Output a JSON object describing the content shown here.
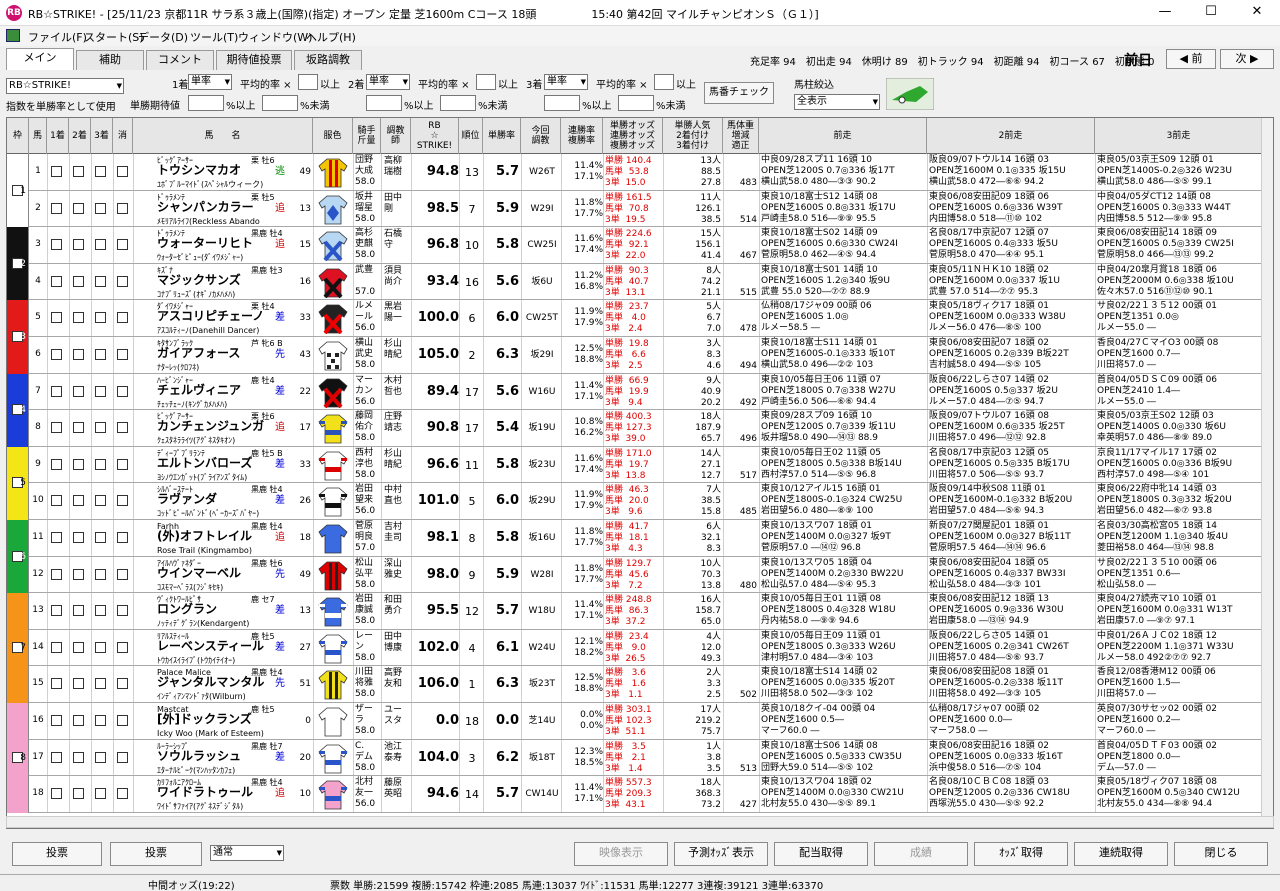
{
  "window": {
    "app_icon_label": "RB",
    "title": "RB☆STRIKE! - [25/11/23 京都11R サラ系３歳上(国際)(指定) オープン 定量 芝1600m Cコース 18頭　　　　　15:40 第42回 マイルチャンピオンＳ（Ｇ１）]",
    "minimize": "—",
    "maximize": "☐",
    "close": "✕"
  },
  "menu": [
    "ファイル(F)",
    "スタート(S)",
    "データ(D)",
    "ツール(T)",
    "ウィンドウ(W)",
    "ヘルプ(H)"
  ],
  "tabs": [
    "メイン",
    "補助",
    "コメント",
    "期待値投票",
    "坂路調教"
  ],
  "race_stats": {
    "text": "充足率 94　初出走 94　休明け 89　初トラック 94　初距離 94　初コース 67　初状態 0",
    "prev_day": "前日",
    "prev_btn": "◀ 前",
    "next_btn": "次 ▶"
  },
  "controls": {
    "profile": "RB☆STRIKE!",
    "use_label": "指数を単勝率として使用",
    "place1": "1着",
    "place2": "2着",
    "place3": "3着",
    "bet_type": "単率",
    "avg_label": "平均的率 ×",
    "above": "以上",
    "tan_exp": "単勝期待値",
    "pct_above": "%以上",
    "pct_below": "%未満",
    "check_btn": "馬番チェック",
    "filter_label": "馬柱絞込",
    "filter_value": "全表示"
  },
  "columns": [
    "枠",
    "馬",
    "1着",
    "2着",
    "3着",
    "消",
    "馬　　名",
    "服色",
    "騎手\n斤量",
    "調教\n師",
    "RB\n☆\nSTRIKE!",
    "順位",
    "単勝率",
    "今回\n調教",
    "連勝率\n複勝率",
    "単勝オッズ\n連勝オッズ\n複勝オッズ",
    "単勝人気\n2着付け\n3着付け",
    "馬体重\n増減\n適正",
    "前走",
    "2前走",
    "3前走"
  ],
  "horses": [
    {
      "waku": "1",
      "num": "1",
      "sire": "ﾋﾞｯｸﾞｱｰｻｰ",
      "sex": "栗 牡6",
      "name": "トウシンマカオ",
      "dam": "ﾕﾎﾞﾌﾞﾙｰﾏｲﾄﾞ(ｽﾍﾟｼｬﾙウィーク)",
      "style": "逃",
      "idx": "49",
      "jockey": "団野\n大成\n58.0",
      "trainer": "高柳\n瑞樹",
      "score": "94.8",
      "rank": "13",
      "win": "5.7",
      "train": "W26T",
      "rate": "11.4%\n17.1%",
      "odds": "単勝 140.4\n馬単  53.8\n3単  15.0",
      "pop": "13人\n88.5\n27.8",
      "wt": "483",
      "p1": [
        "中良09/28スプ11 16頭 10",
        "OPEN芝1200S 0.7◎336 坂17T",
        "横山武58.0 480―③③ 90.2"
      ],
      "p2": [
        "阪良09/07トウル14 16頭 03",
        "OPEN芝1600M 0.1◎335 坂15U",
        "横山武58.0 472―⑥⑥ 94.2"
      ],
      "p3": [
        "東良05/03京王S09 12頭 01",
        "OPEN芝1400S-0.2◎326 W23U",
        "横山武58.0 486―⑤⑤ 99.1"
      ]
    },
    {
      "waku": "1",
      "num": "2",
      "sire": "ﾄﾞｩﾗﾒﾝﾃ",
      "sex": "栗 牡5",
      "name": "シャンパンカラー",
      "dam": "ﾒﾓﾘｱﾙﾗｲﾌ(Reckless Abando",
      "style": "追",
      "idx": "13",
      "jockey": "坂井\n瑠星\n58.0",
      "trainer": "田中\n剛",
      "score": "98.5",
      "rank": "7",
      "win": "5.9",
      "train": "W29I",
      "rate": "11.8%\n17.7%",
      "odds": "単勝 161.5\n馬単  70.8\n3単  19.5",
      "pop": "11人\n126.1\n38.5",
      "wt": "514",
      "p1": [
        "東良10/18富士S12 14頭 08",
        "OPEN芝1600S 0.8◎331 坂17U",
        "戸崎圭58.0 516―⑨⑨ 95.5"
      ],
      "p2": [
        "東良06/08安田記09 18頭 06",
        "OPEN芝1600S 0.6◎336 W39T",
        "内田博58.0 518―⑪⑩ 102"
      ],
      "p3": [
        "中良04/05ダCT12 14頭 08",
        "OPEN芝1600S 0.3◎333 W44T",
        "内田博58.5 512―⑨⑨ 95.8"
      ]
    },
    {
      "waku": "2",
      "num": "3",
      "sire": "ﾄﾞｩﾗﾒﾝﾃ",
      "sex": "黒鹿 牡4",
      "name": "ウォーターリヒト",
      "dam": "ｳｫｰﾀｰｾﾞﾋﾟｭｰ(ﾀﾞｲﾜﾒｼﾞｬｰ)",
      "style": "追",
      "idx": "15",
      "jockey": "高杉\n吏麒\n58.0",
      "trainer": "石橋\n守",
      "score": "96.8",
      "rank": "10",
      "win": "5.8",
      "train": "CW25I",
      "rate": "11.6%\n17.4%",
      "odds": "単勝 224.6\n馬単  92.1\n3単  22.0",
      "pop": "15人\n156.1\n41.4",
      "wt": "467",
      "p1": [
        "東良10/18富士S02 14頭 09",
        "OPEN芝1600S 0.6◎330 CW24I",
        "菅原明58.0 462―④⑤ 94.4"
      ],
      "p2": [
        "名良08/17中京記07 12頭 07",
        "OPEN芝1600S 0.4◎333 坂5U",
        "菅原明58.0 470―④④ 95.1"
      ],
      "p3": [
        "東良06/08安田記14 18頭 09",
        "OPEN芝1600S 0.5◎339 CW25I",
        "菅原明58.0 466―⑬⑬ 99.2"
      ]
    },
    {
      "waku": "2",
      "num": "4",
      "sire": "ｷｽﾞﾅ",
      "sex": "黒鹿 牡3",
      "name": "マジックサンズ",
      "dam": "ｺﾅﾌﾞﾘｭｰｽﾞ(ｵｷﾞﾉｶﾒﾊﾒﾊ)",
      "style": "",
      "idx": "16",
      "jockey": "武豊\n\n57.0",
      "trainer": "須貝\n尚介",
      "score": "93.4",
      "rank": "16",
      "win": "5.6",
      "train": "坂6U",
      "rate": "11.2%\n16.8%",
      "odds": "単勝  90.3\n馬単  40.7\n3単  13.1",
      "pop": "8人\n74.2\n21.1",
      "wt": "515",
      "p1": [
        "東良10/18富士S01 14頭 10",
        "OPEN芝1600S 1.2◎340 坂9U",
        "武豊  55.0 520―⑦⑦ 88.9"
      ],
      "p2": [
        "東良05/11ＮＨＫ10 18頭 02",
        "OPEN芝1600M 0.0◎337 坂1U",
        "武豊  57.0 514―⑦⑦ 95.3"
      ],
      "p3": [
        "中良04/20皐月賞18 18頭 06",
        "OPEN芝2000M 0.6◎338 坂10U",
        "佐々木57.0 516⑪⑫⑩ 90.1"
      ]
    },
    {
      "waku": "3",
      "num": "5",
      "sire": "ﾀﾞｲﾜﾒｼﾞｬｰ",
      "sex": "栗 牡4",
      "name": "アスコリピチェーノ",
      "dam": "ｱｽｺﾙﾃｨｰﾉ(Danehill Dancer)",
      "style": "差",
      "idx": "33",
      "jockey": "ルメ\nール\n56.0",
      "trainer": "黒岩\n陽一",
      "score": "100.0",
      "rank": "6",
      "win": "6.0",
      "train": "CW25T",
      "rate": "11.9%\n17.9%",
      "odds": "単勝  23.7\n馬単   4.0\n3単   2.4",
      "pop": "5人\n6.7\n7.0",
      "wt": "478",
      "p1": [
        "仏稍08/17ジャ09 00頭 06",
        "OPEN芝1600S 1.0◎",
        "ルメー58.5 ―"
      ],
      "p2": [
        "東良05/18ヴィク17 18頭 01",
        "OPEN芝1600M 0.0◎333 W38U",
        "ルメー56.0 476―⑧⑤ 100"
      ],
      "p3": [
        "サ良02/22１３５12 00頭 01",
        "OPEN芝1351 0.0◎",
        "ルメー55.0 ―"
      ]
    },
    {
      "waku": "3",
      "num": "6",
      "sire": "ｷﾀｻﾝﾌﾞﾗｯｸ",
      "sex": "芦 牝6 B",
      "name": "ガイアフォース",
      "dam": "ﾅﾀｰﾚｯ(ｸﾛﾌﾈ)",
      "style": "先",
      "idx": "43",
      "jockey": "横山\n武史\n58.0",
      "trainer": "杉山\n晴紀",
      "score": "105.0",
      "rank": "2",
      "win": "6.3",
      "train": "坂29I",
      "rate": "12.5%\n18.8%",
      "odds": "単勝  19.8\n馬単   6.6\n3単   2.5",
      "pop": "3人\n8.3\n4.6",
      "wt": "494",
      "p1": [
        "東良10/18富士S11 14頭 01",
        "OPEN芝1600S-0.1◎333 坂10T",
        "横山武58.0 496―②② 103"
      ],
      "p2": [
        "東良06/08安田記07 18頭 02",
        "OPEN芝1600S 0.2◎339 B坂22T",
        "吉村誠58.0 494―⑤⑤ 105"
      ],
      "p3": [
        "香良04/27ＣマイO3 00頭 08",
        "OPEN芝1600 0.7―",
        "川田将57.0 ―"
      ]
    },
    {
      "waku": "4",
      "num": "7",
      "sire": "ﾊｰﾋﾞﾝｼﾞｬｰ",
      "sex": "鹿 牡4",
      "name": "チェルヴィニア",
      "dam": "ﾁｪｯﾁｪｰﾉ(ｷﾝｸﾞｶﾒﾊﾒﾊ)",
      "style": "差",
      "idx": "22",
      "jockey": "マー\nカン\n56.0",
      "trainer": "木村\n哲也",
      "score": "89.4",
      "rank": "17",
      "win": "5.6",
      "train": "W16U",
      "rate": "11.4%\n17.1%",
      "odds": "単勝  66.9\n馬単  19.9\n3単   9.4",
      "pop": "9人\n40.9\n20.2",
      "wt": "492",
      "p1": [
        "東良10/05毎日王06 11頭 07",
        "OPEN芝1800S 0.7◎338 W27U",
        "戸崎圭56.0 506―⑥⑥ 94.4"
      ],
      "p2": [
        "阪良06/22しらさ07 14頭 02",
        "OPEN芝1600S 0.5◎337 坂2U",
        "ルメー57.0 484―⑦⑤ 94.7"
      ],
      "p3": [
        "首良04/05ＤＳＣ09 00頭 06",
        "OPEN芝2410 1.4―",
        "ルメー55.0 ―"
      ]
    },
    {
      "waku": "4",
      "num": "8",
      "sire": "ﾋﾞｯｸﾞｱｰｻｰ",
      "sex": "栗 牡6",
      "name": "カンチェンジュンガ",
      "dam": "ｸｪｽﾀﾈﾗﾗｲﾂ(ｱｸﾞﾈｽﾀｷｵﾝ)",
      "style": "追",
      "idx": "17",
      "jockey": "藤岡\n佑介\n58.0",
      "trainer": "庄野\n靖志",
      "score": "90.8",
      "rank": "17",
      "win": "5.4",
      "train": "坂19U",
      "rate": "10.8%\n16.2%",
      "odds": "単勝 400.3\n馬単 127.3\n3単  39.0",
      "pop": "18人\n187.9\n65.7",
      "wt": "496",
      "p1": [
        "東良09/28スプ09 16頭 10",
        "OPEN芝1200S 0.7◎339 坂11U",
        "坂井瑠58.0 490―⑭⑬ 88.9"
      ],
      "p2": [
        "阪良09/07トウル07 16頭 08",
        "OPEN芝1600M 0.6◎335 坂25T",
        "川田将57.0 496―⑫⑫ 92.8"
      ],
      "p3": [
        "東良05/03京王S02 12頭 03",
        "OPEN芝1400S 0.0◎330 坂6U",
        "幸英明57.0 486―⑧⑨ 89.0"
      ]
    },
    {
      "waku": "5",
      "num": "9",
      "sire": "ﾃﾞｨｰﾌﾟﾌﾞﾘﾗﾝﾃ",
      "sex": "鹿 牡5 B",
      "name": "エルトンバローズ",
      "dam": "ﾖｼﾉｳｴﾝｶﾞｯﾄ(ﾌﾞﾗｲｱﾝｽﾞﾀｲﾑ)",
      "style": "差",
      "idx": "33",
      "jockey": "西村\n淳也\n58.0",
      "trainer": "杉山\n晴紀",
      "score": "96.6",
      "rank": "11",
      "win": "5.8",
      "train": "坂23U",
      "rate": "11.6%\n17.4%",
      "odds": "単勝 171.0\n馬単  19.7\n3単  13.8",
      "pop": "14人\n27.1\n12.7",
      "wt": "517",
      "p1": [
        "東良10/05毎日王02 11頭 05",
        "OPEN芝1800S 0.5◎338 B坂14U",
        "西村淳57.0 514―⑤⑤ 96.8"
      ],
      "p2": [
        "名良08/17中京記03 12頭 05",
        "OPEN芝1600S 0.5◎335 B坂17U",
        "川田将57.0 506―⑤⑤ 93.7"
      ],
      "p3": [
        "京良11/17マイル17 17頭 02",
        "OPEN芝1600S 0.0◎336 B坂9U",
        "西村淳57.0 498―⑤④ 101"
      ]
    },
    {
      "waku": "5",
      "num": "10",
      "sire": "ｼﾙﾊﾞｰｽﾃｰﾄ",
      "sex": "黒鹿 牡4",
      "name": "ラヴァンダ",
      "dam": "ｺｯﾄﾞﾋﾟｰﾙﾊﾞﾝﾄﾞ(ﾍﾞｰｶｰｽﾞﾊﾞﾔｰ)",
      "style": "差",
      "idx": "26",
      "jockey": "岩田\n望来\n56.0",
      "trainer": "中村\n直也",
      "score": "101.0",
      "rank": "5",
      "win": "6.0",
      "train": "坂29U",
      "rate": "11.9%\n17.9%",
      "odds": "単勝  46.3\n馬単  20.0\n3単   9.6",
      "pop": "7人\n38.5\n15.8",
      "wt": "485",
      "p1": [
        "東良10/12アイル15 16頭 01",
        "OPEN芝1800S-0.1◎324 CW25U",
        "岩田望56.0 480―⑧⑨ 100"
      ],
      "p2": [
        "阪良09/14中秋S08 11頭 01",
        "OPEN芝1600M-0.1◎332 B坂20U",
        "岩田望57.0 484―⑤⑥ 94.3"
      ],
      "p3": [
        "東良06/22府中牝14 14頭 03",
        "OPEN芝1800S 0.3◎332 坂20U",
        "岩田望56.0 482―⑥⑦ 93.8"
      ]
    },
    {
      "waku": "6",
      "num": "11",
      "sire": "Farhh",
      "sex": "黒鹿 牡4",
      "name": "(外)オフトレイル",
      "dam": "Rose Trail (Kingmambo)",
      "style": "追",
      "idx": "18",
      "jockey": "菅原\n明良\n57.0",
      "trainer": "吉村\n圭司",
      "score": "98.1",
      "rank": "8",
      "win": "5.8",
      "train": "坂16U",
      "rate": "11.8%\n17.7%",
      "odds": "単勝  41.7\n馬単  18.1\n3単   4.3",
      "pop": "6人\n32.1\n8.3",
      "wt": "",
      "p1": [
        "東良10/13スワ07 18頭 01",
        "OPEN芝1400M 0.0◎327 坂9T",
        "菅原明57.0 ―⑭⑫ 96.8"
      ],
      "p2": [
        "新良07/27関屋記01 18頭 01",
        "OPEN芝1600M 0.0◎327 B坂11T",
        "菅原明57.5 464―⑭⑭ 96.6"
      ],
      "p3": [
        "名良03/30高松宮05 18頭 14",
        "OPEN芝1200M 1.1◎340 坂4U",
        "菱田裕58.0 464―⑬⑭ 98.8"
      ]
    },
    {
      "waku": "6",
      "num": "12",
      "sire": "ｱｲﾙﾊｳﾞｧﾈﾀﾞｰ",
      "sex": "黒鹿 牡6",
      "name": "ウインマーベル",
      "dam": "ｺｽﾓﾏｰﾍﾞﾗｽ(ﾌｼﾞｷｾｷ)",
      "style": "先",
      "idx": "49",
      "jockey": "松山\n弘平\n58.0",
      "trainer": "深山\n雅史",
      "score": "98.0",
      "rank": "9",
      "win": "5.9",
      "train": "W28I",
      "rate": "11.8%\n17.7%",
      "odds": "単勝 129.7\n馬単  45.6\n3単   7.2",
      "pop": "10人\n70.3\n13.8",
      "wt": "480",
      "p1": [
        "東良10/13スワ05 18頭 04",
        "OPEN芝1400M 0.2◎330 BW22U",
        "松山弘57.0 484―⑤④ 95.3"
      ],
      "p2": [
        "東良06/08安田記04 18頭 05",
        "OPEN芝1600S 0.4◎337 BW33I",
        "松山弘58.0 484―③③ 101"
      ],
      "p3": [
        "サ良02/22１３５10 00頭 06",
        "OPEN芝1351 0.6―",
        "松山弘58.0 ―"
      ]
    },
    {
      "waku": "7",
      "num": "13",
      "sire": "ｳﾞｨｸﾄﾜｰﾙﾋﾟｻ",
      "sex": "鹿 セ7",
      "name": "ロングラン",
      "dam": "ﾉｯﾃｨﾃﾞｸﾞﾗﾝ(Kendargent)",
      "style": "差",
      "idx": "13",
      "jockey": "岩田\n康誠\n58.0",
      "trainer": "和田\n勇介",
      "score": "95.5",
      "rank": "12",
      "win": "5.7",
      "train": "W18U",
      "rate": "11.4%\n17.1%",
      "odds": "単勝 248.8\n馬単  86.3\n3単  37.2",
      "pop": "16人\n158.7\n65.0",
      "wt": "",
      "p1": [
        "東良10/05毎日王01 11頭 08",
        "OPEN芝1800S 0.4◎328 W18U",
        "丹内祐58.0 ―⑨⑨ 94.6"
      ],
      "p2": [
        "東良06/08安田記12 18頭 13",
        "OPEN芝1600S 0.9◎336 W30U",
        "岩田康58.0 ―⑬⑭ 94.9"
      ],
      "p3": [
        "東良04/27読売マ10 10頭 01",
        "OPEN芝1600M 0.0◎331 W13T",
        "岩田康57.0 ―⑨⑦ 97.1"
      ]
    },
    {
      "waku": "7",
      "num": "14",
      "sire": "ﾘｱﾙｽﾃｨｰﾙ",
      "sex": "鹿 牡5",
      "name": "レーベンスティール",
      "dam": "ﾄｳｶｲｽｲﾗｲﾌﾞ(ﾄｳｶｲﾃｲｵｰ)",
      "style": "差",
      "idx": "27",
      "jockey": "レー\nン\n58.0",
      "trainer": "田中\n博康",
      "score": "102.0",
      "rank": "4",
      "win": "6.1",
      "train": "W24U",
      "rate": "12.1%\n18.2%",
      "odds": "単勝  23.4\n馬単   9.0\n3単  26.5",
      "pop": "4人\n12.0\n49.3",
      "wt": "",
      "p1": [
        "東良10/05毎日王09 11頭 01",
        "OPEN芝1800S 0.3◎333 W26U",
        "津村明57.0 484―③④ 103"
      ],
      "p2": [
        "阪良06/22しらさ05 14頭 01",
        "OPEN芝1600S 0.2◎341 CW26T",
        "川田将57.0 484―⑤⑥ 93.7"
      ],
      "p3": [
        "中良01/26ＡＪＣ02 18頭 12",
        "OPEN芝2200M 1.1◎371 W33U",
        "ルメー58.0 492②⑦⑦ 92.7"
      ]
    },
    {
      "waku": "7",
      "num": "15",
      "sire": "Palace Malice",
      "sex": "黒鹿 牡4",
      "name": "ジャンタルマンタル",
      "dam": "ｲﾝﾃﾞｨｱﾝﾏﾝﾄﾞｧﾀ(Wilburn)",
      "style": "先",
      "idx": "51",
      "jockey": "川田\n将雅\n58.0",
      "trainer": "高野\n友和",
      "score": "106.0",
      "rank": "1",
      "win": "6.3",
      "train": "坂23T",
      "rate": "12.5%\n18.8%",
      "odds": "単勝   3.6\n馬単   1.6\n3単   1.1",
      "pop": "2人\n3.3\n2.5",
      "wt": "502",
      "p1": [
        "東良10/18富士S14 14頭 02",
        "OPEN芝1600S 0.0◎335 坂20T",
        "川田将58.0 502―③③ 102"
      ],
      "p2": [
        "東良06/08安田記08 18頭 01",
        "OPEN芝1600S-0.2◎338 坂11T",
        "川田将58.0 492―③③ 105"
      ],
      "p3": [
        "香良12/08香港M12 00頭 06",
        "OPEN芝1600 1.5―",
        "川田将57.0 ―"
      ]
    },
    {
      "waku": "8",
      "num": "16",
      "sire": "Mastcat",
      "sex": "鹿 牡5",
      "name": "[外]ドックランズ",
      "dam": "Icky Woo (Mark of Esteem)",
      "style": "",
      "idx": "0",
      "jockey": "ザー\nラ\n58.0",
      "trainer": "ユー\nスタ",
      "score": "0.0",
      "rank": "18",
      "win": "0.0",
      "train": "芝14U",
      "rate": "0.0%\n0.0%",
      "odds": "単勝 303.1\n馬単 102.3\n3単  51.1",
      "pop": "17人\n219.2\n75.7",
      "wt": "",
      "p1": [
        "英良10/18クイ-04 00頭 04",
        "OPEN芝1600 0.5―",
        "マーフ60.0 ―"
      ],
      "p2": [
        "仏稍08/17ジャ07 00頭 02",
        "OPEN芝1600 0.0―",
        "マーフ58.0 ―"
      ],
      "p3": [
        "英良07/30サセッ02 00頭 02",
        "OPEN芝1600 0.2―",
        "マーフ60.0 ―"
      ]
    },
    {
      "waku": "8",
      "num": "17",
      "sire": "ﾙｰﾗｰｼｯﾌﾟ",
      "sex": "黒鹿 牡7",
      "name": "ソウルラッシュ",
      "dam": "ｴﾀｰﾅﾙﾋﾟｰｸ(ﾏﾝﾊｯﾀﾝｶﾌｪ)",
      "style": "差",
      "idx": "20",
      "jockey": "C.\nデム\n58.0",
      "trainer": "池江\n泰寿",
      "score": "104.0",
      "rank": "3",
      "win": "6.2",
      "train": "坂18T",
      "rate": "12.3%\n18.5%",
      "odds": "単勝   3.5\n馬単   2.1\n3単   1.4",
      "pop": "1人\n3.8\n3.5",
      "wt": "513",
      "p1": [
        "東良10/18富士S06 14頭 08",
        "OPEN芝1600S 0.5◎333 CW35U",
        "団野大59.0 514―⑤⑤ 102"
      ],
      "p2": [
        "東良06/08安田記16 18頭 02",
        "OPEN芝1600S 0.0◎333 坂16T",
        "浜中俊58.0 516―⑦⑤ 104"
      ],
      "p3": [
        "首良04/05ＤＴＦ03 00頭 02",
        "OPEN芝1800 0.0―",
        "デム―57.0 ―"
      ]
    },
    {
      "waku": "8",
      "num": "18",
      "sire": "ｶﾘﾌｫﾙﾆｱｸﾛｰﾑ",
      "sex": "黒鹿 牡4",
      "name": "ワイドラトゥール",
      "dam": "ﾜｲﾄﾞｻﾌｧｲｱ(ｱｸﾞﾈｽﾃﾞｼﾞﾀﾙ)",
      "style": "追",
      "idx": "10",
      "jockey": "北村\n友一\n56.0",
      "trainer": "藤原\n英昭",
      "score": "94.6",
      "rank": "14",
      "win": "5.7",
      "train": "CW14U",
      "rate": "11.4%\n17.1%",
      "odds": "単勝 557.3\n馬単 209.3\n3単  43.1",
      "pop": "18人\n368.3\n73.2",
      "wt": "427",
      "p1": [
        "東良10/13スワ04 18頭 02",
        "OPEN芝1400M 0.0◎330 CW21U",
        "北村友55.0 430―⑤⑤ 89.1"
      ],
      "p2": [
        "名良08/10ＣＢＣ08 18頭 03",
        "OPEN芝1200S 0.2◎336 CW18U",
        "西塚洸55.0 430―⑤⑤ 92.2"
      ],
      "p3": [
        "東良05/18ヴィク07 18頭 08",
        "OPEN芝1600M 0.5◎340 CW12U",
        "北村友55.0 434―⑧⑧ 94.4"
      ]
    }
  ],
  "waku_colors": {
    "1": "#ffffff",
    "2": "#111111",
    "3": "#e21a1a",
    "4": "#1a3cd8",
    "5": "#f4e616",
    "6": "#19a839",
    "7": "#f59418",
    "8": "#f3a2cc"
  },
  "bottom_buttons": {
    "vote": "投票",
    "vote2": "投票",
    "mode": "通常",
    "video": "映像表示",
    "pred_odds": "予測ｵｯｽﾞ表示",
    "bet_fetch": "配当取得",
    "result": "成績",
    "odds_fetch": "ｵｯｽﾞ取得",
    "combo_fetch": "連続取得",
    "close": "閉じる"
  },
  "status": {
    "mid_odds": "中間オッズ(19:22)",
    "votes": "票数 単勝:21599 複勝:15742 枠連:2085 馬連:13037 ﾜｲﾄﾞ:11531 馬単:12277 3連複:39121 3連単:63370"
  }
}
